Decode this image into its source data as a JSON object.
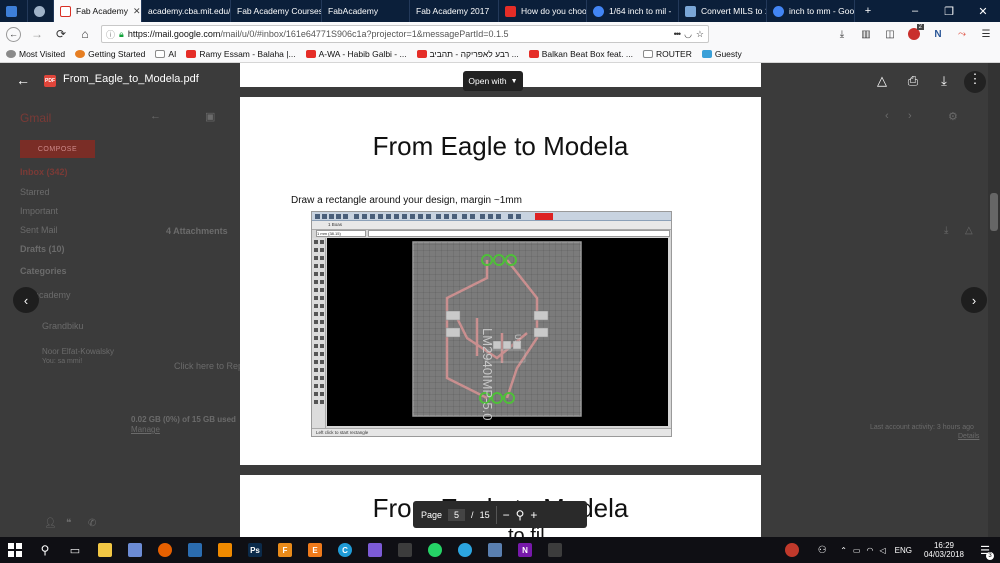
{
  "browser": {
    "tabs": [
      {
        "label": "",
        "favicon": "window-list-icon",
        "color": "#3d7fd9"
      },
      {
        "label": "",
        "favicon": "globe-icon",
        "color": "#9fb2c8"
      },
      {
        "label": "Fab Academy",
        "favicon": "gmail-icon",
        "color": "#d93025",
        "active": true
      },
      {
        "label": "academy.cba.mit.edu/",
        "favicon": "page-icon",
        "color": "#ffffff"
      },
      {
        "label": "Fab Academy Courses",
        "favicon": "page-icon",
        "color": "#ffffff"
      },
      {
        "label": "FabAcademy",
        "favicon": "page-icon",
        "color": "#ffffff"
      },
      {
        "label": "Fab Academy 2017",
        "favicon": "page-icon",
        "color": "#ffffff"
      },
      {
        "label": "How do you choo",
        "favicon": "youtube-icon",
        "color": "#e52d27"
      },
      {
        "label": "1/64 inch to mil -",
        "favicon": "google-icon",
        "color": "#4285f4"
      },
      {
        "label": "Convert MILS to 1",
        "favicon": "page-icon",
        "color": "#7aa6d6"
      },
      {
        "label": "inch to mm - Goo",
        "favicon": "google-icon",
        "color": "#4285f4"
      }
    ],
    "new_tab": "+",
    "url_host": "https://mail.google.com",
    "url_path": "/mail/u/0/#inbox/161e64771S906c1a?projector=1&messagePartId=0.1.5",
    "menu_dots": "•••",
    "bookmarks": [
      {
        "label": "Most Visited",
        "color": "#8a8a8a"
      },
      {
        "label": "Getting Started",
        "color": "#e67e22"
      },
      {
        "label": "AI",
        "color": "#8a8a8a"
      },
      {
        "label": "Ramy Essam - Balaha |...",
        "color": "#e52d27"
      },
      {
        "label": "A-WA - Habib Galbi - ...",
        "color": "#e52d27"
      },
      {
        "label": "רבע לאפריקה - תהביב ...",
        "color": "#e52d27"
      },
      {
        "label": "Balkan Beat Box feat. ...",
        "color": "#e52d27"
      },
      {
        "label": "ROUTER",
        "color": "#8a8a8a"
      },
      {
        "label": "Guesty",
        "color": "#3aa0d8"
      }
    ],
    "badge_count": "2"
  },
  "gmail": {
    "app": "Gmail",
    "compose": "COMPOSE",
    "nav": [
      "Inbox (342)",
      "Starred",
      "Important",
      "Sent Mail",
      "Drafts (10)"
    ],
    "categories": "Categories",
    "folder": "academy",
    "contacts": [
      "Grandbiku",
      "Noor Elfat-Kowalsky",
      "You: sa mmi!"
    ],
    "attachments": "4 Attachments",
    "storage": "0.02 GB (0%) of 15 GB used",
    "manage": "Manage",
    "reply_hint": "Click here to Reply",
    "activity": "Last account activity: 3 hours ago",
    "details": "Details"
  },
  "viewer": {
    "file_name": "From_Eagle_to_Modela.pdf",
    "pdf_badge": "PDF",
    "open_with": "Open with",
    "page1_title": "From Eagle to Modela",
    "page1_text": "Draw a rectangle around your design,  margin ~1mm",
    "page2_title": "From Eagle to Modela",
    "page2_partial": "to fil",
    "page_label": "Page",
    "page_current": "5",
    "page_sep": "/",
    "page_total": "15",
    "shot_tab": "1 Boas",
    "shot_combo": "1 mm (38.15)",
    "shot_status": "Left click to start rectangle",
    "chip_label": "LM2940IMP-5.0",
    "chip_u": "U1"
  },
  "taskbar": {
    "apps": [
      {
        "name": "file-explorer-icon",
        "color": "#f2c744",
        "glyph": ""
      },
      {
        "name": "tablet-icon",
        "color": "#6c8cd5",
        "glyph": ""
      },
      {
        "name": "firefox-icon",
        "color": "#e66000",
        "glyph": ""
      },
      {
        "name": "window-icon",
        "color": "#2b6cb0",
        "glyph": ""
      },
      {
        "name": "vlc-icon",
        "color": "#f08a00",
        "glyph": ""
      },
      {
        "name": "photoshop-icon",
        "color": "#0b2a4a",
        "glyph": "Ps"
      },
      {
        "name": "fusion-icon",
        "color": "#e98b1a",
        "glyph": "F"
      },
      {
        "name": "eagle-icon",
        "color": "#ef7a1b",
        "glyph": "E"
      },
      {
        "name": "ccleaner-icon",
        "color": "#1f9bd6",
        "glyph": "C"
      },
      {
        "name": "3d-icon",
        "color": "#7c5bd6",
        "glyph": ""
      },
      {
        "name": "calculator-icon",
        "color": "#3c3c3c",
        "glyph": ""
      },
      {
        "name": "whatsapp-icon",
        "color": "#25d366",
        "glyph": ""
      },
      {
        "name": "telegram-icon",
        "color": "#2ca5e0",
        "glyph": ""
      },
      {
        "name": "onenote-alt-icon",
        "color": "#5a7fb0",
        "glyph": ""
      },
      {
        "name": "onenote-icon",
        "color": "#7719aa",
        "glyph": "N"
      },
      {
        "name": "photos-icon",
        "color": "#3c3c3c",
        "glyph": ""
      }
    ],
    "lang": "ENG",
    "time": "16:29",
    "date": "04/03/2018",
    "notif": "3"
  }
}
